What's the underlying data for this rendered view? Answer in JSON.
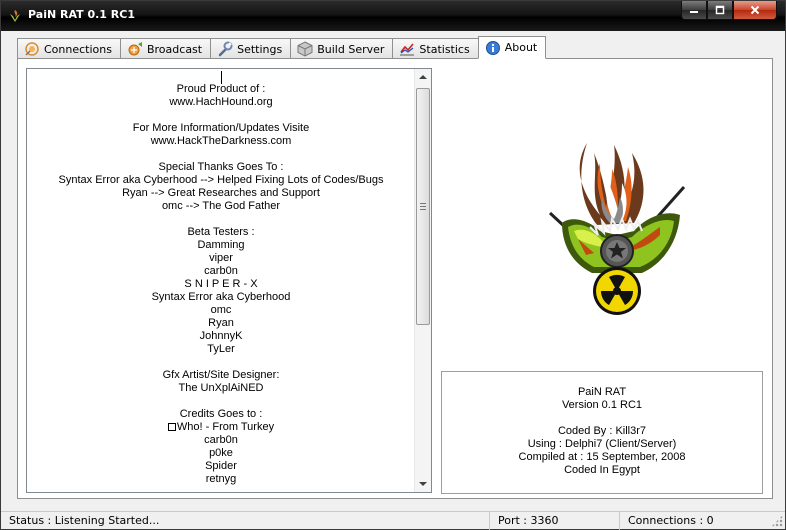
{
  "window": {
    "title": "PaiN RAT 0.1 RC1"
  },
  "tabs": [
    {
      "label": "Connections",
      "icon": "connections-icon"
    },
    {
      "label": "Broadcast",
      "icon": "broadcast-icon"
    },
    {
      "label": "Settings",
      "icon": "wrench-icon"
    },
    {
      "label": "Build Server",
      "icon": "box-icon"
    },
    {
      "label": "Statistics",
      "icon": "chart-icon"
    },
    {
      "label": "About",
      "icon": "info-icon",
      "active": true
    }
  ],
  "about_text": [
    "Proud Product of :",
    "www.HachHound.org",
    "",
    "For More Information/Updates Visite",
    "www.HackTheDarkness.com",
    "",
    "Special Thanks Goes To :",
    "Syntax Error aka Cyberhood --> Helped Fixing Lots of Codes/Bugs",
    "Ryan --> Great Researches and Support",
    "omc --> The God Father",
    "",
    "Beta Testers :",
    "Damming",
    "viper",
    "carb0n",
    "S N I P E R - X",
    "Syntax Error aka Cyberhood",
    "omc",
    "Ryan",
    "JohnnyK",
    "TyLer",
    "",
    "Gfx Artist/Site Designer:",
    "The UnXplAiNED",
    "",
    "Credits Goes to :",
    "Who! - From Turkey",
    "carb0n",
    "p0ke",
    "Spider",
    "retnyg"
  ],
  "info": {
    "name": "PaiN RAT",
    "version": "Version 0.1 RC1",
    "blank": "",
    "coded_by": "Coded By : Kill3r7",
    "using": "Using : Delphi7 (Client/Server)",
    "compiled": "Compiled at : 15 September, 2008",
    "origin": "Coded In Egypt"
  },
  "status": {
    "status": "Status : Listening Started...",
    "port": "Port : 3360",
    "connections": "Connections : 0"
  },
  "colors": {
    "titlebar": "#000000",
    "logo_flame_brown": "#6b3a1c",
    "logo_flame_orange": "#e0601a",
    "logo_shield_green": "#8fc31f",
    "logo_radiation_yellow": "#f2d600"
  }
}
